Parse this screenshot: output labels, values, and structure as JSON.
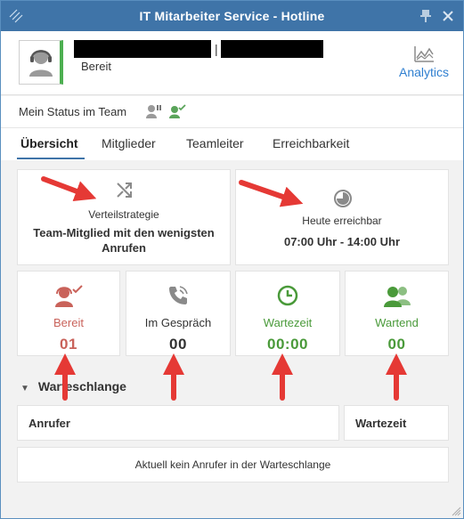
{
  "window": {
    "title": "IT Mitarbeiter Service - Hotline"
  },
  "header": {
    "status": "Bereit",
    "separator": "|",
    "analytics_label": "Analytics"
  },
  "team": {
    "label": "Mein Status im Team"
  },
  "tabs": [
    {
      "label": "Übersicht",
      "active": true
    },
    {
      "label": "Mitglieder",
      "active": false
    },
    {
      "label": "Teamleiter",
      "active": false
    },
    {
      "label": "Erreichbarkeit",
      "active": false
    }
  ],
  "overview": {
    "strategy": {
      "label": "Verteilstrategie",
      "value": "Team-Mitglied mit den wenigsten Anrufen"
    },
    "reachable": {
      "label": "Heute erreichbar",
      "value": "07:00 Uhr - 14:00 Uhr"
    },
    "stats": [
      {
        "label": "Bereit",
        "value": "01",
        "color": "#c9625a",
        "icon": "headset-check-icon"
      },
      {
        "label": "Im Gespräch",
        "value": "00",
        "color": "#333333",
        "icon": "phone-icon"
      },
      {
        "label": "Wartezeit",
        "value": "00:00",
        "color": "#4a9a3a",
        "icon": "clock-icon"
      },
      {
        "label": "Wartend",
        "value": "00",
        "color": "#4a9a3a",
        "icon": "users-icon"
      }
    ]
  },
  "queue": {
    "title": "Warteschlange",
    "col_caller": "Anrufer",
    "col_wait": "Wartezeit",
    "empty_text": "Aktuell kein Anrufer in der Warteschlange"
  },
  "colors": {
    "titlebar": "#3f74a8",
    "accent": "#2f7fd0",
    "status_green": "#4caf50",
    "annotation_arrow": "#e53935"
  }
}
